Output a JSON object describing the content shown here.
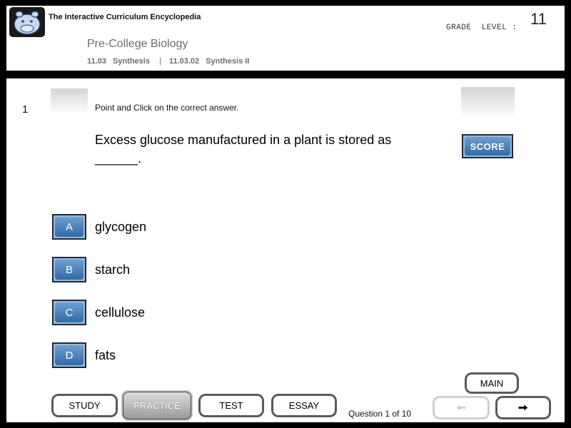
{
  "header": {
    "encyclopedia_title": "The Interactive Curriculum Encyclopedia",
    "grade_label": "GRADE  LEVEL :",
    "grade_value": "11",
    "course_title": "Pre-College Biology",
    "breadcrumb": {
      "code1": "11.03",
      "topic1": "Synthesis",
      "separator": "|",
      "code2": "11.03.02",
      "topic2": "Synthesis II"
    }
  },
  "question": {
    "number": "1",
    "instruction": "Point and Click on the correct answer.",
    "text": "Excess glucose manufactured in a plant is stored as ______.",
    "score_label": "SCORE"
  },
  "options": [
    {
      "letter": "A",
      "text": "glycogen"
    },
    {
      "letter": "B",
      "text": "starch"
    },
    {
      "letter": "C",
      "text": "cellulose"
    },
    {
      "letter": "D",
      "text": "fats"
    }
  ],
  "nav": {
    "study": "STUDY",
    "practice": "PRACTICE",
    "test": "TEST",
    "essay": "ESSAY",
    "main": "MAIN",
    "counter": "Question 1 of 10",
    "prev_icon": "arrow-left",
    "next_icon": "arrow-right"
  },
  "colors": {
    "button_blue": "#2f6aa8",
    "button_border": "#1b2a3d",
    "muted_text": "#6c6c6c"
  }
}
